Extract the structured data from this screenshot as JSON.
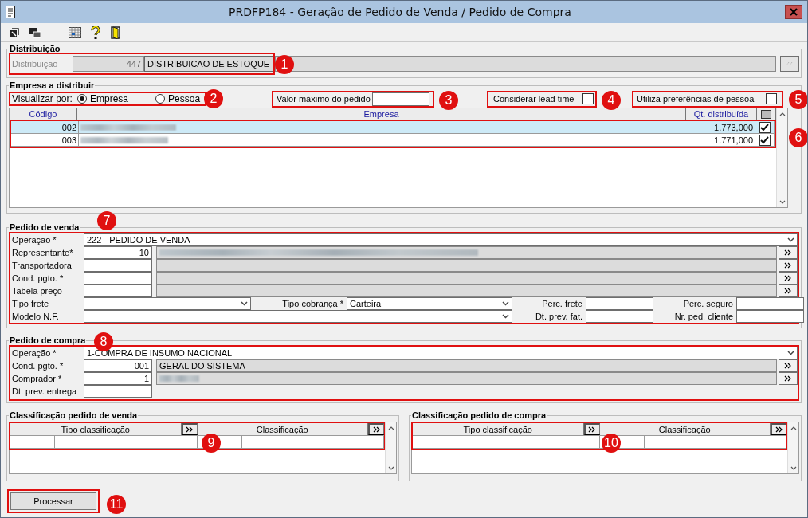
{
  "window": {
    "title": "PRDFP184 - Geração de Pedido de Venda / Pedido de Compra"
  },
  "distribuicao": {
    "title": "Distribuição",
    "label": "Distribuição",
    "code": "447",
    "name": "DISTRIBUICAO DE ESTOQUE",
    "callout": "1"
  },
  "empresa": {
    "title": "Empresa a distribuir",
    "view_label": "Visualizar por:",
    "view_callout": "2",
    "view_options": [
      {
        "label": "Empresa",
        "selected": true
      },
      {
        "label": "Pessoa",
        "selected": false
      }
    ],
    "max_value": {
      "label": "Valor máximo do pedido",
      "callout": "3"
    },
    "lead_time": {
      "label": "Considerar lead time",
      "checked": false,
      "callout": "4"
    },
    "preferences": {
      "label": "Utiliza preferências de pessoa",
      "checked": false,
      "callout": "5"
    },
    "table": {
      "columns": [
        "Código",
        "Empresa",
        "Qt. distribuída"
      ],
      "select_all": {
        "disabled": true
      },
      "callout": "6",
      "rows": [
        {
          "code": "002",
          "blurred": true,
          "qty": "1.773,000",
          "checked": true,
          "selected": true
        },
        {
          "code": "003",
          "blurred": true,
          "qty": "1.771,000",
          "checked": true,
          "selected": false
        }
      ]
    }
  },
  "venda": {
    "title": "Pedido de venda",
    "callout": "7",
    "operation": {
      "label": "Operação *",
      "value": "222 - PEDIDO DE VENDA"
    },
    "lookups": [
      {
        "label": "Representante*",
        "code": "10",
        "blurred": true
      },
      {
        "label": "Transportadora",
        "blurred": false
      },
      {
        "label": "Cond. pgto. *",
        "blurred": false
      },
      {
        "label": "Tabela preço",
        "blurred": false
      }
    ],
    "tipo_frete": {
      "label": "Tipo frete"
    },
    "tipo_cobranca": {
      "label": "Tipo cobrança *",
      "value": "Carteira"
    },
    "perc_frete": {
      "label": "Perc. frete"
    },
    "perc_seguro": {
      "label": "Perc. seguro"
    },
    "modelo_nf": {
      "label": "Modelo N.F."
    },
    "dt_prev_fat": {
      "label": "Dt. prev. fat."
    },
    "nr_ped_cliente": {
      "label": "Nr. ped. cliente"
    }
  },
  "compra": {
    "title": "Pedido de compra",
    "callout": "8",
    "operation": {
      "label": "Operação *",
      "value": "1-COMPRA DE INSUMO NACIONAL"
    },
    "lookups": [
      {
        "label": "Cond. pgto. *",
        "code": "001",
        "name": "GERAL DO SISTEMA",
        "blurred": false
      },
      {
        "label": "Comprador *",
        "code": "1",
        "blurred": true
      }
    ],
    "dt_prev_entrega": {
      "label": "Dt. prev. entrega"
    }
  },
  "classificacao": [
    {
      "title": "Classificação pedido de venda",
      "columns": [
        "Tipo classificação",
        "Classificação"
      ],
      "callout": "9"
    },
    {
      "title": "Classificação pedido de compra",
      "columns": [
        "Tipo classificação",
        "Classificação"
      ],
      "callout": "10"
    }
  ],
  "process_button": {
    "label": "Processar",
    "callout": "11"
  }
}
